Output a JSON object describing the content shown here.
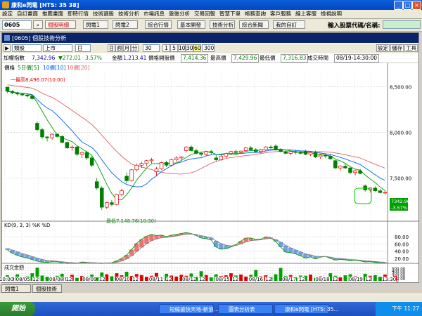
{
  "window": {
    "title": "康和e閃電 [HTS: 35 38]"
  },
  "menu": [
    "設定",
    "自訂畫面",
    "推薦畫面",
    "即時行情",
    "技術選股",
    "技術分析",
    "市場訊息",
    "盤後分析",
    "交易回報",
    "智慧下單",
    "帳務查詢",
    "客戶服務",
    "線上客服",
    "檢視說明"
  ],
  "toolbar": {
    "code": "0605",
    "buttons": [
      "個股明細",
      "閃電1",
      "閃電2",
      "綜合行情",
      "基本開發",
      "技術分析",
      "綜合新聞",
      "我的自訂"
    ],
    "search_label": "輸入股票代碼/名稱:"
  },
  "panel": {
    "title": "[0605] 個股技術分析",
    "category": "類股",
    "market": "上市",
    "period_value": "日",
    "periods": [
      "日",
      "週",
      "月",
      "分"
    ],
    "count": "30",
    "minutes": [
      "1",
      "5",
      "10",
      "30",
      "60"
    ],
    "active_minute": "60",
    "count2": "300",
    "right_buttons": [
      "設定",
      "儲存",
      "工具"
    ]
  },
  "info": {
    "name": "加權指數",
    "price": "7,342.96",
    "change": "▼272.01",
    "pct": "3.57%",
    "amount_label": "金額",
    "amount": "1,213.41",
    "open_label": "價格開盤價",
    "open": "7,414.36",
    "high_label": "最高價",
    "high": "7,429.96",
    "low_label": "最低價",
    "low": "7,316.83",
    "time_label": "成交時間",
    "time": "08/19-14:30:00"
  },
  "legend": {
    "price": "價格",
    "ma5": "5日價[5]",
    "ma10": "10價[10]",
    "ma20": "10價[20]"
  },
  "annotations": {
    "high": "一最高8,496.07(10:00)",
    "low": "最低7,148.76(10:30)",
    "last_price": "7342.96",
    "last_pct": "-3.57%"
  },
  "kd_label": "KD(9, 3, 3) %K %D",
  "volume_label": "成交金額",
  "chart_data": [
    {
      "type": "line",
      "title": "",
      "yticks": [
        "8,500.00",
        "8,000.00",
        "7,500.00"
      ],
      "ylim": [
        7050,
        8650
      ],
      "xticks": [
        "10:00",
        "08/05",
        "12",
        "08/08",
        "12",
        "08/09",
        "12",
        "08/10",
        "12",
        "08/11",
        "12",
        "08/12",
        "12",
        "08/15",
        "12",
        "08/16",
        "12",
        "08/17",
        "12",
        "08/18",
        "12",
        "08/19",
        "12",
        "13:30"
      ],
      "candles": [
        [
          8496,
          8496,
          8430,
          8450
        ],
        [
          8450,
          8462,
          8420,
          8432
        ],
        [
          8432,
          8445,
          8405,
          8420
        ],
        [
          8420,
          8430,
          8395,
          8410
        ],
        [
          8410,
          8418,
          8380,
          8398
        ],
        [
          8398,
          8402,
          8360,
          8370
        ],
        [
          8100,
          8120,
          8010,
          8030
        ],
        [
          8030,
          8050,
          7930,
          7950
        ],
        [
          7950,
          7960,
          7900,
          7940
        ],
        [
          7940,
          7990,
          7920,
          7980
        ],
        [
          7980,
          7990,
          7940,
          7955
        ],
        [
          7955,
          7970,
          7880,
          7890
        ],
        [
          7890,
          7900,
          7820,
          7830
        ],
        [
          7830,
          7860,
          7800,
          7840
        ],
        [
          7840,
          7850,
          7740,
          7760
        ],
        [
          7760,
          7790,
          7720,
          7780
        ],
        [
          7780,
          7800,
          7700,
          7720
        ],
        [
          7720,
          7740,
          7620,
          7640
        ],
        [
          7460,
          7500,
          7370,
          7390
        ],
        [
          7390,
          7410,
          7149,
          7180
        ],
        [
          7180,
          7240,
          7160,
          7230
        ],
        [
          7230,
          7260,
          7190,
          7210
        ],
        [
          7210,
          7330,
          7200,
          7320
        ],
        [
          7320,
          7380,
          7300,
          7360
        ],
        [
          7520,
          7560,
          7440,
          7470
        ],
        [
          7470,
          7600,
          7460,
          7590
        ],
        [
          7590,
          7660,
          7570,
          7640
        ],
        [
          7640,
          7680,
          7610,
          7660
        ],
        [
          7660,
          7700,
          7630,
          7690
        ],
        [
          7690,
          7720,
          7660,
          7700
        ],
        [
          7570,
          7620,
          7520,
          7600
        ],
        [
          7600,
          7680,
          7590,
          7670
        ],
        [
          7670,
          7690,
          7620,
          7640
        ],
        [
          7640,
          7710,
          7630,
          7700
        ],
        [
          7700,
          7740,
          7680,
          7720
        ],
        [
          7720,
          7740,
          7690,
          7730
        ],
        [
          7800,
          7850,
          7780,
          7840
        ],
        [
          7840,
          7860,
          7790,
          7800
        ],
        [
          7800,
          7820,
          7760,
          7770
        ],
        [
          7770,
          7790,
          7740,
          7760
        ],
        [
          7760,
          7800,
          7740,
          7790
        ],
        [
          7790,
          7810,
          7760,
          7780
        ],
        [
          7720,
          7750,
          7680,
          7700
        ],
        [
          7700,
          7760,
          7690,
          7740
        ],
        [
          7740,
          7780,
          7720,
          7770
        ],
        [
          7770,
          7800,
          7750,
          7790
        ],
        [
          7790,
          7810,
          7760,
          7780
        ],
        [
          7780,
          7800,
          7770,
          7795
        ],
        [
          7800,
          7840,
          7790,
          7830
        ],
        [
          7830,
          7850,
          7800,
          7810
        ],
        [
          7810,
          7830,
          7780,
          7790
        ],
        [
          7790,
          7820,
          7770,
          7810
        ],
        [
          7810,
          7850,
          7800,
          7840
        ],
        [
          7840,
          7860,
          7820,
          7830
        ],
        [
          7850,
          7870,
          7800,
          7810
        ],
        [
          7810,
          7830,
          7780,
          7790
        ],
        [
          7790,
          7810,
          7760,
          7770
        ],
        [
          7770,
          7800,
          7750,
          7790
        ],
        [
          7790,
          7810,
          7760,
          7780
        ],
        [
          7780,
          7800,
          7760,
          7770
        ],
        [
          7790,
          7810,
          7750,
          7760
        ],
        [
          7760,
          7790,
          7740,
          7780
        ],
        [
          7780,
          7800,
          7720,
          7730
        ],
        [
          7730,
          7760,
          7710,
          7750
        ],
        [
          7750,
          7770,
          7720,
          7740
        ],
        [
          7740,
          7760,
          7700,
          7710
        ],
        [
          7690,
          7700,
          7600,
          7610
        ],
        [
          7610,
          7640,
          7580,
          7630
        ],
        [
          7630,
          7660,
          7600,
          7610
        ],
        [
          7610,
          7620,
          7540,
          7560
        ],
        [
          7560,
          7590,
          7530,
          7580
        ],
        [
          7580,
          7600,
          7540,
          7550
        ],
        [
          7414,
          7430,
          7350,
          7370
        ],
        [
          7370,
          7400,
          7340,
          7390
        ],
        [
          7390,
          7410,
          7350,
          7360
        ],
        [
          7360,
          7380,
          7330,
          7340
        ],
        [
          7340,
          7360,
          7317,
          7343
        ]
      ]
    },
    {
      "type": "line",
      "title": "",
      "yticks": [
        "80.00",
        "60.00",
        "40.00",
        "20.00"
      ],
      "ylim": [
        10,
        100
      ]
    },
    {
      "type": "bar",
      "title": "",
      "yticks": [
        "500.00",
        "400.00",
        "300.00",
        "200.00",
        "100.00",
        "(億)"
      ],
      "ylim": [
        0,
        580
      ],
      "values": [
        220,
        150,
        260,
        110,
        180,
        300,
        520,
        210,
        160,
        130,
        200,
        280,
        150,
        240,
        120,
        190,
        170,
        250,
        140,
        330,
        260,
        180,
        300,
        220,
        360,
        190,
        270,
        230,
        160,
        200,
        310,
        150,
        280,
        210,
        170,
        240,
        200,
        290,
        160,
        380,
        230,
        140,
        260,
        190,
        220,
        300,
        210,
        250,
        170,
        240,
        430,
        180,
        220,
        160,
        260,
        510,
        190,
        230,
        140,
        210,
        200,
        250,
        120,
        180,
        160,
        300,
        200,
        140,
        220,
        260,
        180,
        140,
        280,
        200,
        230,
        160,
        250,
        140,
        190
      ]
    }
  ],
  "bottom_tabs": [
    "閃電1",
    "個股技術"
  ],
  "taskbar": {
    "start": "開始",
    "tasks": [
      "短線搶快天地-新浪...",
      "圖表分析表",
      "康和e閃電 [HTS: 35..."
    ],
    "clock": "下午 11:27"
  }
}
